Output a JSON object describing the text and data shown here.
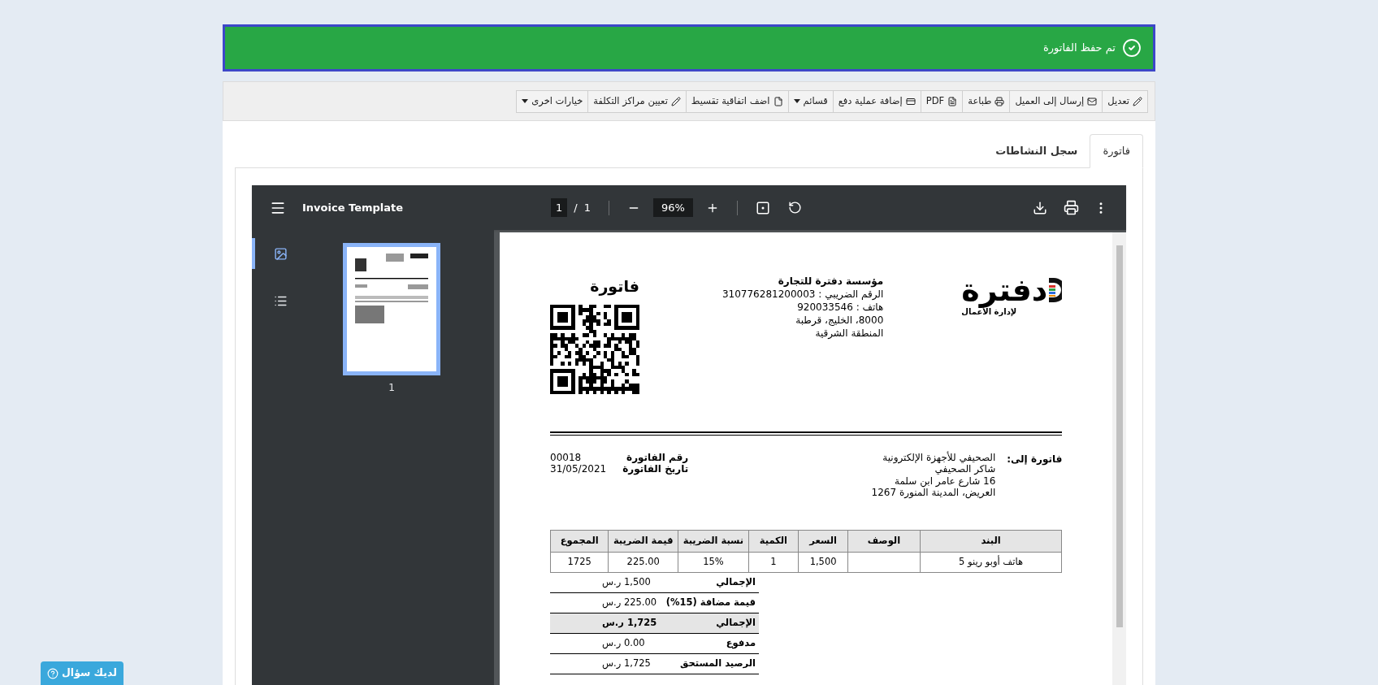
{
  "alert": {
    "message": "تم حفظ الفاتورة"
  },
  "toolbar": [
    {
      "label": "تعديل",
      "dropdown": false
    },
    {
      "label": "إرسال إلى العميل",
      "dropdown": false
    },
    {
      "label": "طباعة",
      "dropdown": false
    },
    {
      "label": "PDF",
      "dropdown": false
    },
    {
      "label": "إضافة عملية دفع",
      "dropdown": false
    },
    {
      "label": "قسائم",
      "dropdown": true
    },
    {
      "label": "اضف اتفاقية تقسيط",
      "dropdown": false
    },
    {
      "label": "تعيين مراكز التكلفة",
      "dropdown": false
    },
    {
      "label": "خيارات اخرى",
      "dropdown": true
    }
  ],
  "tabs": [
    {
      "label": "فاتورة",
      "selected": true
    },
    {
      "label": "سجل النشاطات",
      "selected": false
    }
  ],
  "viewer": {
    "title": "Invoice Template",
    "current_page": "1",
    "separator": "/",
    "total_pages": "1",
    "zoom": "96%",
    "sidebar_views": [
      {
        "selected": true
      },
      {
        "selected": false
      }
    ],
    "thumbnails": [
      {
        "label": "1",
        "selected": true
      }
    ]
  },
  "invoice": {
    "logo": {
      "name": "دفترة",
      "tagline": "لإدارة الأعمال"
    },
    "company": {
      "name": "مؤسسة دفترة للتجارة",
      "lines": [
        "الرقم الضريبي : 310776281200003",
        "هاتف : 920033546",
        "8000، الخليج، قرطبة",
        "المنطقة الشرقية"
      ]
    },
    "title": "فاتورة",
    "bill_to": {
      "label": "فاتورة إلى:",
      "lines": [
        "الصحيفي للأجهزة الإلكترونية",
        "شاكر الصحيفي",
        "16 شارع عامر ابن سلمة",
        "العريض، المدينة المنورة 1267"
      ]
    },
    "meta": [
      {
        "label": "رقم الفاتورة",
        "value": "00018"
      },
      {
        "label": "تاريخ الفاتورة",
        "value": "31/05/2021"
      }
    ],
    "table": {
      "columns": [
        "البند",
        "الوصف",
        "السعر",
        "الكمية",
        "نسبة الضريبة",
        "قيمة الضريبة",
        "المجموع"
      ],
      "rows": [
        [
          "هاتف أوبو رينو 5",
          null,
          "1,500",
          "1",
          "15%",
          "225.00",
          "1725"
        ]
      ]
    },
    "totals": [
      {
        "label": "الإجمالي",
        "value": "1,500 ر.س",
        "highlighted": false
      },
      {
        "label": "قيمة مضافة (15%)",
        "value": "225.00 ر.س",
        "highlighted": false
      },
      {
        "label": "الإجمالي",
        "value": "1,725 ر.س",
        "highlighted": true
      },
      {
        "label": "مدفوع",
        "value": "0.00 ر.س",
        "highlighted": false
      },
      {
        "label": "الرصيد المستحق",
        "value": "1,725 ر.س",
        "highlighted": false
      }
    ]
  },
  "help_button": {
    "label": "لديك سؤال"
  }
}
